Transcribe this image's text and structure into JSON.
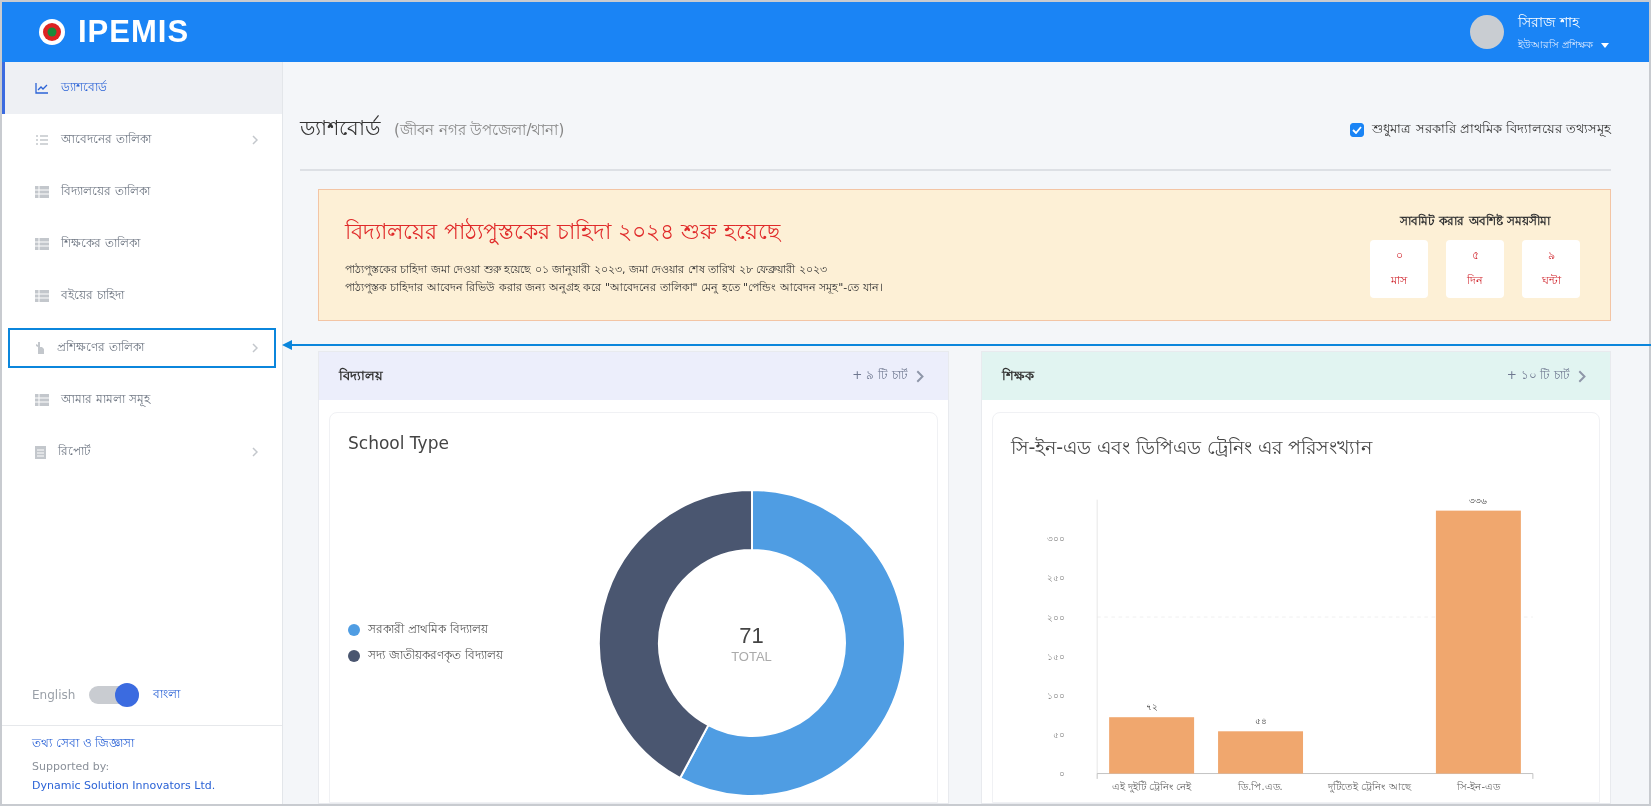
{
  "header": {
    "logo": "IPEMIS",
    "user": {
      "name": "সিরাজ শাহ",
      "role": "ইউআরসি প্রশিক্ষক"
    }
  },
  "sidebar": {
    "items": [
      {
        "label": "ড্যাশবোর্ড",
        "kind": "chart",
        "selected": true,
        "expandable": false,
        "annotated": false
      },
      {
        "label": "আবেদনের তালিকা",
        "kind": "list",
        "selected": false,
        "expandable": true,
        "annotated": false
      },
      {
        "label": "বিদ্যালয়ের তালিকা",
        "kind": "grid",
        "selected": false,
        "expandable": false,
        "annotated": false
      },
      {
        "label": "শিক্ষকের তালিকা",
        "kind": "grid",
        "selected": false,
        "expandable": false,
        "annotated": false
      },
      {
        "label": "বইয়ের চাহিদা",
        "kind": "grid",
        "selected": false,
        "expandable": false,
        "annotated": false
      },
      {
        "label": "প্রশিক্ষণের তালিকা",
        "kind": "hand",
        "selected": false,
        "expandable": true,
        "annotated": true
      },
      {
        "label": "আমার মামলা সমূহ",
        "kind": "grid",
        "selected": false,
        "expandable": false,
        "annotated": false
      },
      {
        "label": "রিপোর্ট",
        "kind": "clipboard",
        "selected": false,
        "expandable": true,
        "annotated": false
      }
    ],
    "language": {
      "left": "English",
      "right": "বাংলা",
      "on": true
    },
    "help_link": "তথ্য সেবা ও জিজ্ঞাসা",
    "supported_by": "Supported by:",
    "company_link": "Dynamic Solution Innovators Ltd."
  },
  "page": {
    "title": "ড্যাশবোর্ড",
    "subtitle": "(জীবন নগর উপজেলা/থানা)",
    "filter": {
      "label": "শুধুমাত্র সরকারি প্রাথমিক বিদ্যালয়ের তথ্যসমূহ",
      "checked": true
    }
  },
  "notice": {
    "title": "বিদ্যালয়ের পাঠ্যপুস্তকের চাহিদা ২০২৪ শুরু হয়েছে",
    "lines": [
      "পাঠ্যপুস্তকের চাহিদা জমা দেওয়া শুরু হয়েছে ০১ জানুয়ারী ২০২৩, জমা দেওয়ার শেষ তারিখ ২৮ ফেব্রুয়ারী ২০২৩",
      "পাঠ্যপুস্তক চাহিদার আবেদন রিভিউ করার জন্য অনুগ্রহ করে \"আবেদনের তালিকা\" মেনু হতে \"পেন্ডিং আবেদন সমূহ\"-তে যান।"
    ],
    "countdown": {
      "title": "সাবমিট করার অবশিষ্ট সময়সীমা",
      "units": [
        {
          "value": "০",
          "unit": "মাস"
        },
        {
          "value": "৫",
          "unit": "দিন"
        },
        {
          "value": "৯",
          "unit": "ঘন্টা"
        }
      ]
    }
  },
  "panels": [
    {
      "kind": "donut",
      "title": "বিদ্যালয়",
      "more": "+ ৯ টি চার্ট",
      "card": {
        "title": "School Type",
        "total": "71",
        "total_label": "TOTAL",
        "legend": [
          {
            "label": "সরকারী প্রাথমিক বিদ্যালয়",
            "color": "#4f9de3"
          },
          {
            "label": "সদ্য জাতীয়করণকৃত বিদ্যালয়",
            "color": "#4a5670"
          }
        ]
      }
    },
    {
      "kind": "bar",
      "title": "শিক্ষক",
      "more": "+ ১০ টি চার্ট",
      "card": {
        "title": "সি-ইন-এড এবং ডিপিএড ট্রেনিং এর পরিসংখ্যান",
        "chart_data": {
          "type": "bar",
          "categories": [
            "এই দুইটি ট্রেনিং নেই",
            "ডি.পি.এড.",
            "দুটিতেই ট্রেনিং আছে",
            "সি-ইন-এড"
          ],
          "series": [
            {
              "color": "#f0a76e",
              "values": [
                72,
                54,
                0,
                336
              ]
            }
          ],
          "ylim": [
            0,
            350
          ],
          "yticks": [
            {
              "value": 0,
              "label": "০"
            },
            {
              "value": 50,
              "label": "৫০"
            },
            {
              "value": 100,
              "label": "১০০"
            },
            {
              "value": 150,
              "label": "১৫০"
            },
            {
              "value": 200,
              "label": "২০০"
            },
            {
              "value": 250,
              "label": "২৫০"
            },
            {
              "value": 300,
              "label": "৩০০"
            }
          ],
          "value_labels": [
            "৭২",
            "৫৪",
            null,
            "৩৩৬"
          ]
        }
      }
    }
  ]
}
